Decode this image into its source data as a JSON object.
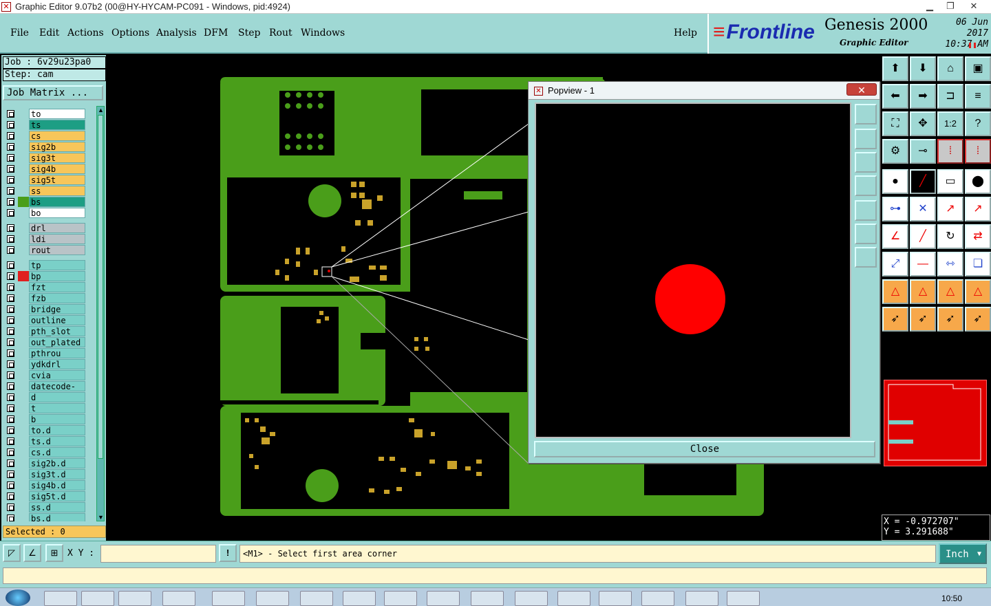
{
  "window": {
    "title": "Graphic Editor 9.07b2 (00@HY-HYCAM-PC091 - Windows, pid:4924)",
    "minimize": "▁",
    "restore": "❐",
    "close": "✕"
  },
  "menu": {
    "file": "File",
    "edit": "Edit",
    "actions": "Actions",
    "options": "Options",
    "analysis": "Analysis",
    "dfm": "DFM",
    "step": "Step",
    "rout": "Rout",
    "windows": "Windows",
    "help": "Help"
  },
  "brand": {
    "logo": "Frontline",
    "product": "Genesis 2000",
    "subtitle": "Graphic Editor",
    "date": "06 Jun 2017",
    "time": "10:37 AM"
  },
  "job": {
    "job_label": "Job : 6v29u23pa0",
    "step_label": "Step: cam",
    "matrix_button": "Job Matrix ..."
  },
  "layers": [
    {
      "name": "to",
      "color": "#ffffff",
      "swatch": ""
    },
    {
      "name": "ts",
      "color": "#1d9e84",
      "swatch": ""
    },
    {
      "name": "cs",
      "color": "#f7c65a",
      "swatch": ""
    },
    {
      "name": "sig2b",
      "color": "#f7c65a",
      "swatch": ""
    },
    {
      "name": "sig3t",
      "color": "#f7c65a",
      "swatch": ""
    },
    {
      "name": "sig4b",
      "color": "#f7c65a",
      "swatch": ""
    },
    {
      "name": "sig5t",
      "color": "#f7c65a",
      "swatch": ""
    },
    {
      "name": "ss",
      "color": "#f7c65a",
      "swatch": ""
    },
    {
      "name": "bs",
      "color": "#1d9e84",
      "swatch": "#4a9e1a"
    },
    {
      "name": "bo",
      "color": "#ffffff",
      "swatch": ""
    },
    {
      "name": "drl",
      "color": "#b9c3c7",
      "swatch": ""
    },
    {
      "name": "ldi",
      "color": "#b9c3c7",
      "swatch": ""
    },
    {
      "name": "rout",
      "color": "#b9c3c7",
      "swatch": ""
    },
    {
      "name": "tp",
      "color": "#7ad0c8",
      "swatch": ""
    },
    {
      "name": "bp",
      "color": "#7ad0c8",
      "swatch": "#e02020"
    },
    {
      "name": "fzt",
      "color": "#7ad0c8",
      "swatch": ""
    },
    {
      "name": "fzb",
      "color": "#7ad0c8",
      "swatch": ""
    },
    {
      "name": "bridge",
      "color": "#7ad0c8",
      "swatch": ""
    },
    {
      "name": "outline",
      "color": "#7ad0c8",
      "swatch": ""
    },
    {
      "name": "pth_slot",
      "color": "#7ad0c8",
      "swatch": ""
    },
    {
      "name": "out_plated",
      "color": "#7ad0c8",
      "swatch": ""
    },
    {
      "name": "pthrou",
      "color": "#7ad0c8",
      "swatch": ""
    },
    {
      "name": "ydkdrl",
      "color": "#7ad0c8",
      "swatch": ""
    },
    {
      "name": "cvia",
      "color": "#7ad0c8",
      "swatch": ""
    },
    {
      "name": "datecode-to",
      "color": "#7ad0c8",
      "swatch": ""
    },
    {
      "name": "d",
      "color": "#7ad0c8",
      "swatch": ""
    },
    {
      "name": "t",
      "color": "#7ad0c8",
      "swatch": ""
    },
    {
      "name": "b",
      "color": "#7ad0c8",
      "swatch": ""
    },
    {
      "name": "to.d",
      "color": "#7ad0c8",
      "swatch": ""
    },
    {
      "name": "ts.d",
      "color": "#7ad0c8",
      "swatch": ""
    },
    {
      "name": "cs.d",
      "color": "#7ad0c8",
      "swatch": ""
    },
    {
      "name": "sig2b.d",
      "color": "#7ad0c8",
      "swatch": ""
    },
    {
      "name": "sig3t.d",
      "color": "#7ad0c8",
      "swatch": ""
    },
    {
      "name": "sig4b.d",
      "color": "#7ad0c8",
      "swatch": ""
    },
    {
      "name": "sig5t.d",
      "color": "#7ad0c8",
      "swatch": ""
    },
    {
      "name": "ss.d",
      "color": "#7ad0c8",
      "swatch": ""
    },
    {
      "name": "bs.d",
      "color": "#7ad0c8",
      "swatch": ""
    }
  ],
  "selected": "Selected : 0",
  "popview": {
    "title": "Popview - 1",
    "close_x": "✕",
    "close_button": "Close"
  },
  "coords": {
    "x": "X = -0.972707\"",
    "y": "Y = 3.291688\""
  },
  "bottom": {
    "xy_label": "X Y :",
    "xy_value": "",
    "info_icon": "!",
    "message": "<M1> - Select first area corner",
    "unit": "Inch"
  },
  "taskbar": {
    "clock": "10:50"
  },
  "colors": {
    "board": "#4a9e1a",
    "pad": "#c9a22a",
    "highlight": "#e00000",
    "panel": "#9fd8d4"
  }
}
